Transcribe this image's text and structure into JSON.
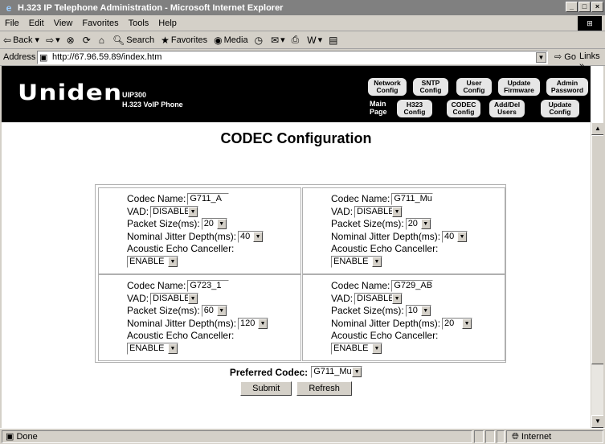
{
  "window": {
    "title": "H.323 IP Telephone Administration - Microsoft Internet Explorer"
  },
  "menu": [
    "File",
    "Edit",
    "View",
    "Favorites",
    "Tools",
    "Help"
  ],
  "toolbar": {
    "back": "Back",
    "search": "Search",
    "favorites": "Favorites",
    "media": "Media"
  },
  "address": {
    "label": "Address",
    "url": "http://67.96.59.89/index.htm",
    "go": "Go",
    "links": "Links"
  },
  "header": {
    "brand": "Uniden",
    "model_line1": "UIP300",
    "model_line2": "H.323 VoIP Phone",
    "main_page": "Main Page",
    "nav": [
      {
        "label": "Network Config"
      },
      {
        "label": "SNTP Config"
      },
      {
        "label": "User Config"
      },
      {
        "label": "Update Firmware"
      },
      {
        "label": "Admin Password"
      },
      {
        "label": "H323 Config"
      },
      {
        "label": "CODEC Config"
      },
      {
        "label": "Add/Del Users"
      },
      {
        "label": "Update Config"
      }
    ]
  },
  "page": {
    "title": "CODEC Configuration"
  },
  "labels": {
    "codec_name": "Codec Name:",
    "vad": "VAD:",
    "packet_size": "Packet Size(ms):",
    "jitter": "Nominal Jitter Depth(ms):",
    "echo": "Acoustic Echo Canceller:"
  },
  "codecs": [
    {
      "name": "G711_A",
      "vad": "DISABLE",
      "packet": "20",
      "jitter": "40",
      "echo": "ENABLE"
    },
    {
      "name": "G711_Mu",
      "vad": "DISABLE",
      "packet": "20",
      "jitter": "40",
      "echo": "ENABLE"
    },
    {
      "name": "G723_1",
      "vad": "DISABLE",
      "packet": "60",
      "jitter": "120",
      "echo": "ENABLE"
    },
    {
      "name": "G729_AB",
      "vad": "DISABLE",
      "packet": "10",
      "jitter": "20",
      "echo": "ENABLE"
    }
  ],
  "preferred": {
    "label": "Preferred Codec:",
    "value": "G711_Mu"
  },
  "buttons": {
    "submit": "Submit",
    "refresh": "Refresh"
  },
  "status": {
    "text": "Done",
    "zone": "Internet"
  }
}
